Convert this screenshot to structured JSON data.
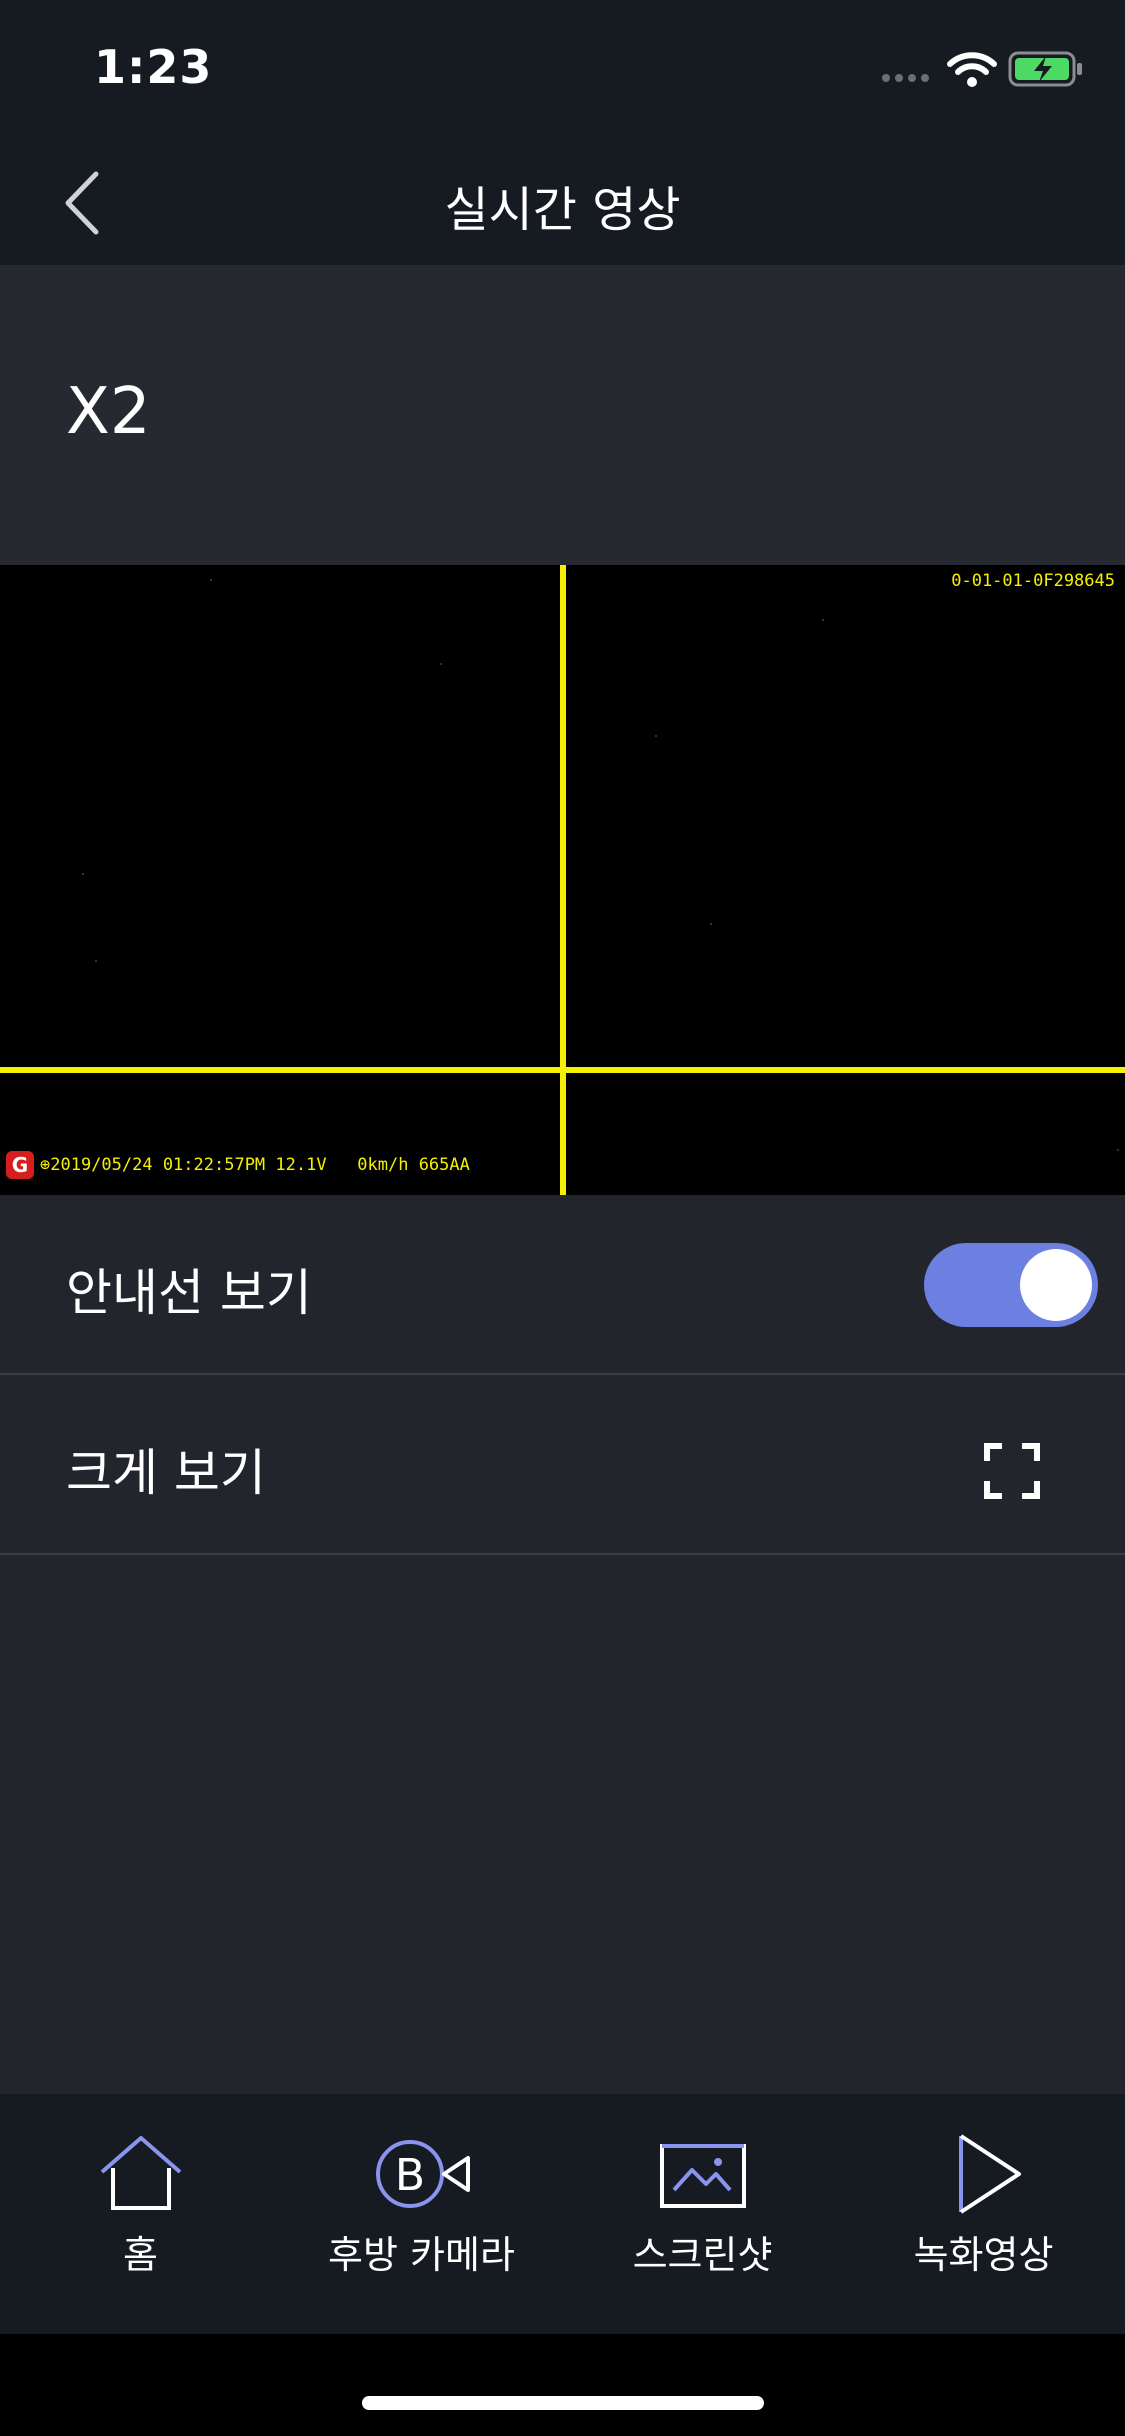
{
  "status": {
    "time": "1:23"
  },
  "nav": {
    "title": "실시간 영상"
  },
  "device": {
    "name": "X2"
  },
  "video": {
    "serial": "0-01-01-0F298645",
    "overlay_logo": "G",
    "overlay_text": "⊕2019/05/24 01:22:57PM 12.1V   0km/h 665AA"
  },
  "settings": {
    "guide_label": "안내선 보기",
    "guide_enabled": true,
    "fullscreen_label": "크게 보기"
  },
  "tabs": [
    {
      "label": "홈",
      "icon": "home-icon"
    },
    {
      "label": "후방 카메라",
      "icon": "rear-camera-icon"
    },
    {
      "label": "스크린샷",
      "icon": "screenshot-icon"
    },
    {
      "label": "녹화영상",
      "icon": "play-icon"
    }
  ],
  "colors": {
    "accent": "#6b80e0",
    "guide_line": "#f5f000",
    "icon_stroke": "#8a93ee"
  }
}
